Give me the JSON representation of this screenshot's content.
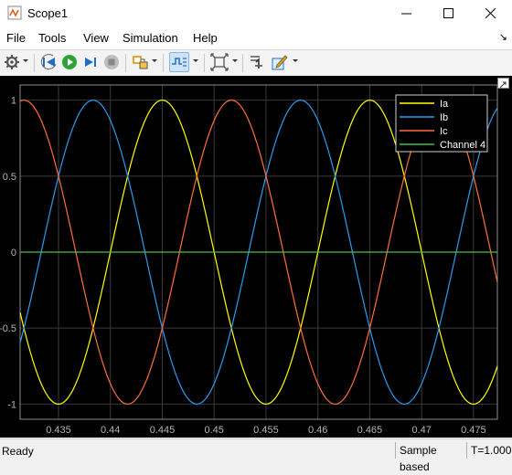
{
  "window": {
    "title": "Scope1"
  },
  "menu": {
    "items": [
      "File",
      "Tools",
      "View",
      "Simulation",
      "Help"
    ]
  },
  "status": {
    "ready": "Ready",
    "mode": "Sample based",
    "time": "T=1.000"
  },
  "chart_data": {
    "type": "line",
    "background": "#000000",
    "grid": true,
    "xlim": [
      0.4313,
      0.4773
    ],
    "ylim": [
      -1.1,
      1.1
    ],
    "xticks": [
      0.435,
      0.44,
      0.445,
      0.45,
      0.455,
      0.46,
      0.465,
      0.47,
      0.475
    ],
    "xtick_labels": [
      "0.435",
      "0.44",
      "0.445",
      "0.45",
      "0.455",
      "0.46",
      "0.465",
      "0.47",
      "0.475"
    ],
    "yticks": [
      -1,
      -0.5,
      0,
      0.5,
      1
    ],
    "ytick_labels": [
      "-1",
      "-0.5",
      "0",
      "0.5",
      "1"
    ],
    "legend_position": "top-right",
    "series": [
      {
        "name": "Ia",
        "color": "#ffff00",
        "function": "sin(2*pi*50*t)",
        "amplitude": 1,
        "frequency_hz": 50,
        "phase_deg": 0
      },
      {
        "name": "Ib",
        "color": "#2a9cf0",
        "function": "sin(2*pi*50*t + 120deg)",
        "amplitude": 1,
        "frequency_hz": 50,
        "phase_deg": 120
      },
      {
        "name": "Ic",
        "color": "#ff6e3c",
        "function": "sin(2*pi*50*t - 120deg)",
        "amplitude": 1,
        "frequency_hz": 50,
        "phase_deg": -120
      },
      {
        "name": "Channel 4",
        "color": "#49c049",
        "function": "0",
        "amplitude": 0,
        "frequency_hz": 0,
        "phase_deg": 0
      }
    ]
  }
}
